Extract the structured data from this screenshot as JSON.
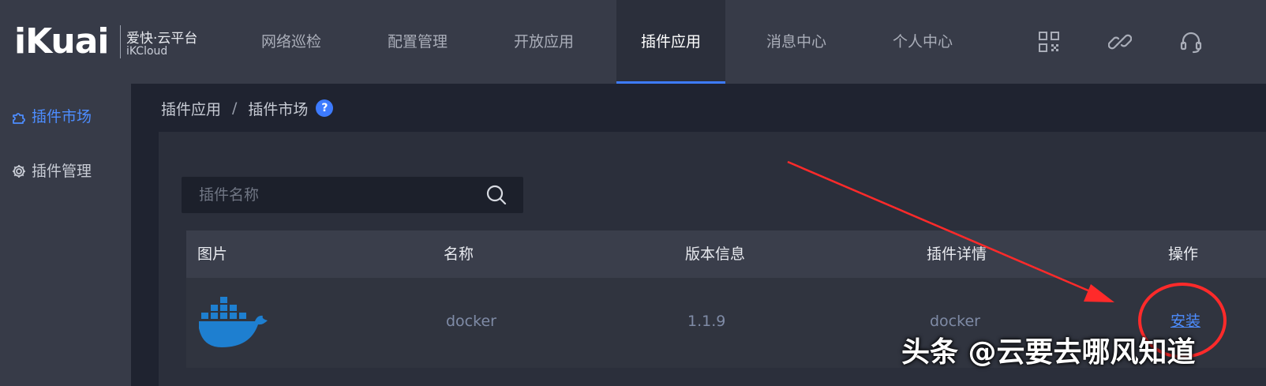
{
  "header": {
    "logo": "iKuai",
    "logo_sub_cn": "爱快·云平台",
    "logo_sub_en": "iKCloud",
    "tabs": [
      {
        "label": "网络巡检"
      },
      {
        "label": "配置管理"
      },
      {
        "label": "开放应用"
      },
      {
        "label": "插件应用",
        "active": true
      },
      {
        "label": "消息中心"
      },
      {
        "label": "个人中心"
      }
    ],
    "icons": [
      "qr-code-icon",
      "link-icon",
      "headset-icon"
    ]
  },
  "sidebar": {
    "items": [
      {
        "label": "插件市场",
        "icon": "puzzle-icon",
        "active": true
      },
      {
        "label": "插件管理",
        "icon": "gear-icon",
        "active": false
      }
    ]
  },
  "breadcrumb": {
    "items": [
      "插件应用",
      "插件市场"
    ],
    "separator": "/",
    "help": "?"
  },
  "search": {
    "placeholder": "插件名称",
    "value": ""
  },
  "table": {
    "columns": [
      "图片",
      "名称",
      "版本信息",
      "插件详情",
      "操作"
    ],
    "rows": [
      {
        "image": "docker-logo",
        "name": "docker",
        "version": "1.1.9",
        "detail": "docker",
        "action": "安装"
      }
    ]
  },
  "watermark": "头条 @云要去哪风知道",
  "colors": {
    "accent": "#3d7bff",
    "nav_bg": "#373b48",
    "content_bg": "#2b2f3b",
    "annotation": "#ff2a2a"
  }
}
